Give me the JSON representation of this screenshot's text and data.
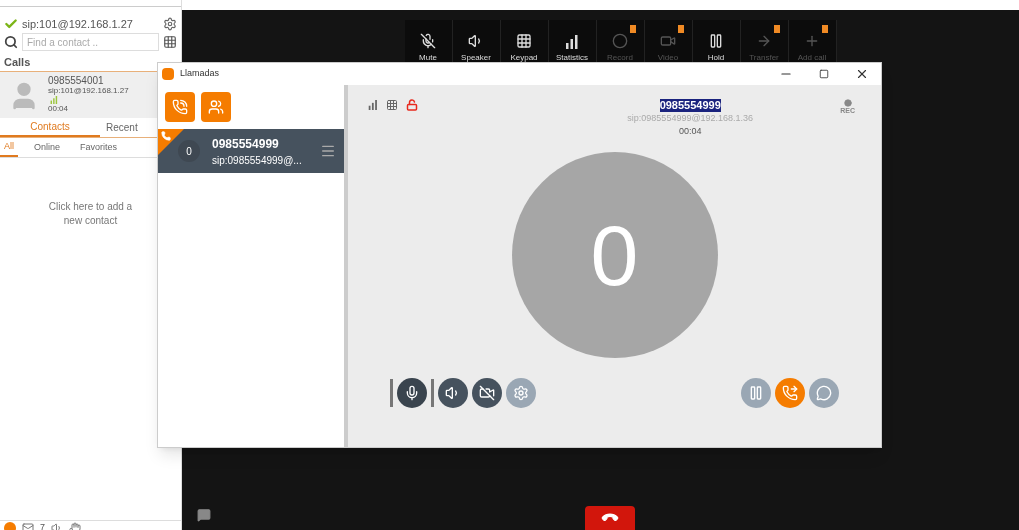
{
  "account": {
    "address": "sip:101@192.168.1.27",
    "registered": true
  },
  "search": {
    "placeholder": "Find a contact .."
  },
  "calls_header": "Calls",
  "active_call": {
    "number": "0985554001",
    "address": "sip:101@192.168.1.27",
    "duration": "00:04"
  },
  "tabs": [
    {
      "label": "Contacts",
      "selected": true
    },
    {
      "label": "Recent",
      "selected": false
    }
  ],
  "filters": [
    {
      "label": "All",
      "selected": true
    },
    {
      "label": "Online",
      "selected": false
    },
    {
      "label": "Favorites",
      "selected": false
    }
  ],
  "empty_message": "Click here to add a new contact",
  "status_bar": {
    "unread": "7"
  },
  "toolbar": [
    {
      "kind": "mute",
      "label": "Mute",
      "disabled": false,
      "badge": false
    },
    {
      "kind": "speaker",
      "label": "Speaker",
      "disabled": false,
      "badge": false
    },
    {
      "kind": "keypad",
      "label": "Keypad",
      "disabled": false,
      "badge": false
    },
    {
      "kind": "statistics",
      "label": "Statistics",
      "disabled": false,
      "badge": false
    },
    {
      "kind": "record",
      "label": "Record",
      "disabled": true,
      "badge": true
    },
    {
      "kind": "video",
      "label": "Video",
      "disabled": true,
      "badge": true
    },
    {
      "kind": "hold",
      "label": "Hold",
      "disabled": false,
      "badge": false
    },
    {
      "kind": "transfer",
      "label": "Transfer",
      "disabled": true,
      "badge": true
    },
    {
      "kind": "add",
      "label": "Add call",
      "disabled": true,
      "badge": true
    }
  ],
  "dialog": {
    "title": "Llamadas",
    "calls": [
      {
        "avatar": "0",
        "number": "0985554999",
        "address": "sip:0985554999@...",
        "selected": true
      }
    ],
    "call": {
      "number": "0985554999",
      "address": "sip:0985554999@192.168.1.36",
      "duration": "00:04",
      "avatar": "0",
      "number_highlighted": true,
      "rec_label": "REC"
    },
    "left_controls": [
      {
        "kind": "mic",
        "active": true,
        "disabled": false
      },
      {
        "kind": "speaker",
        "active": false,
        "disabled": false
      },
      {
        "kind": "video",
        "active": false,
        "disabled": false
      },
      {
        "kind": "settings",
        "active": false,
        "disabled": true
      }
    ],
    "right_controls": [
      {
        "kind": "hold",
        "active": false,
        "disabled": true
      },
      {
        "kind": "transfer",
        "active": false,
        "disabled": false
      },
      {
        "kind": "chat",
        "active": false,
        "disabled": true
      }
    ]
  }
}
